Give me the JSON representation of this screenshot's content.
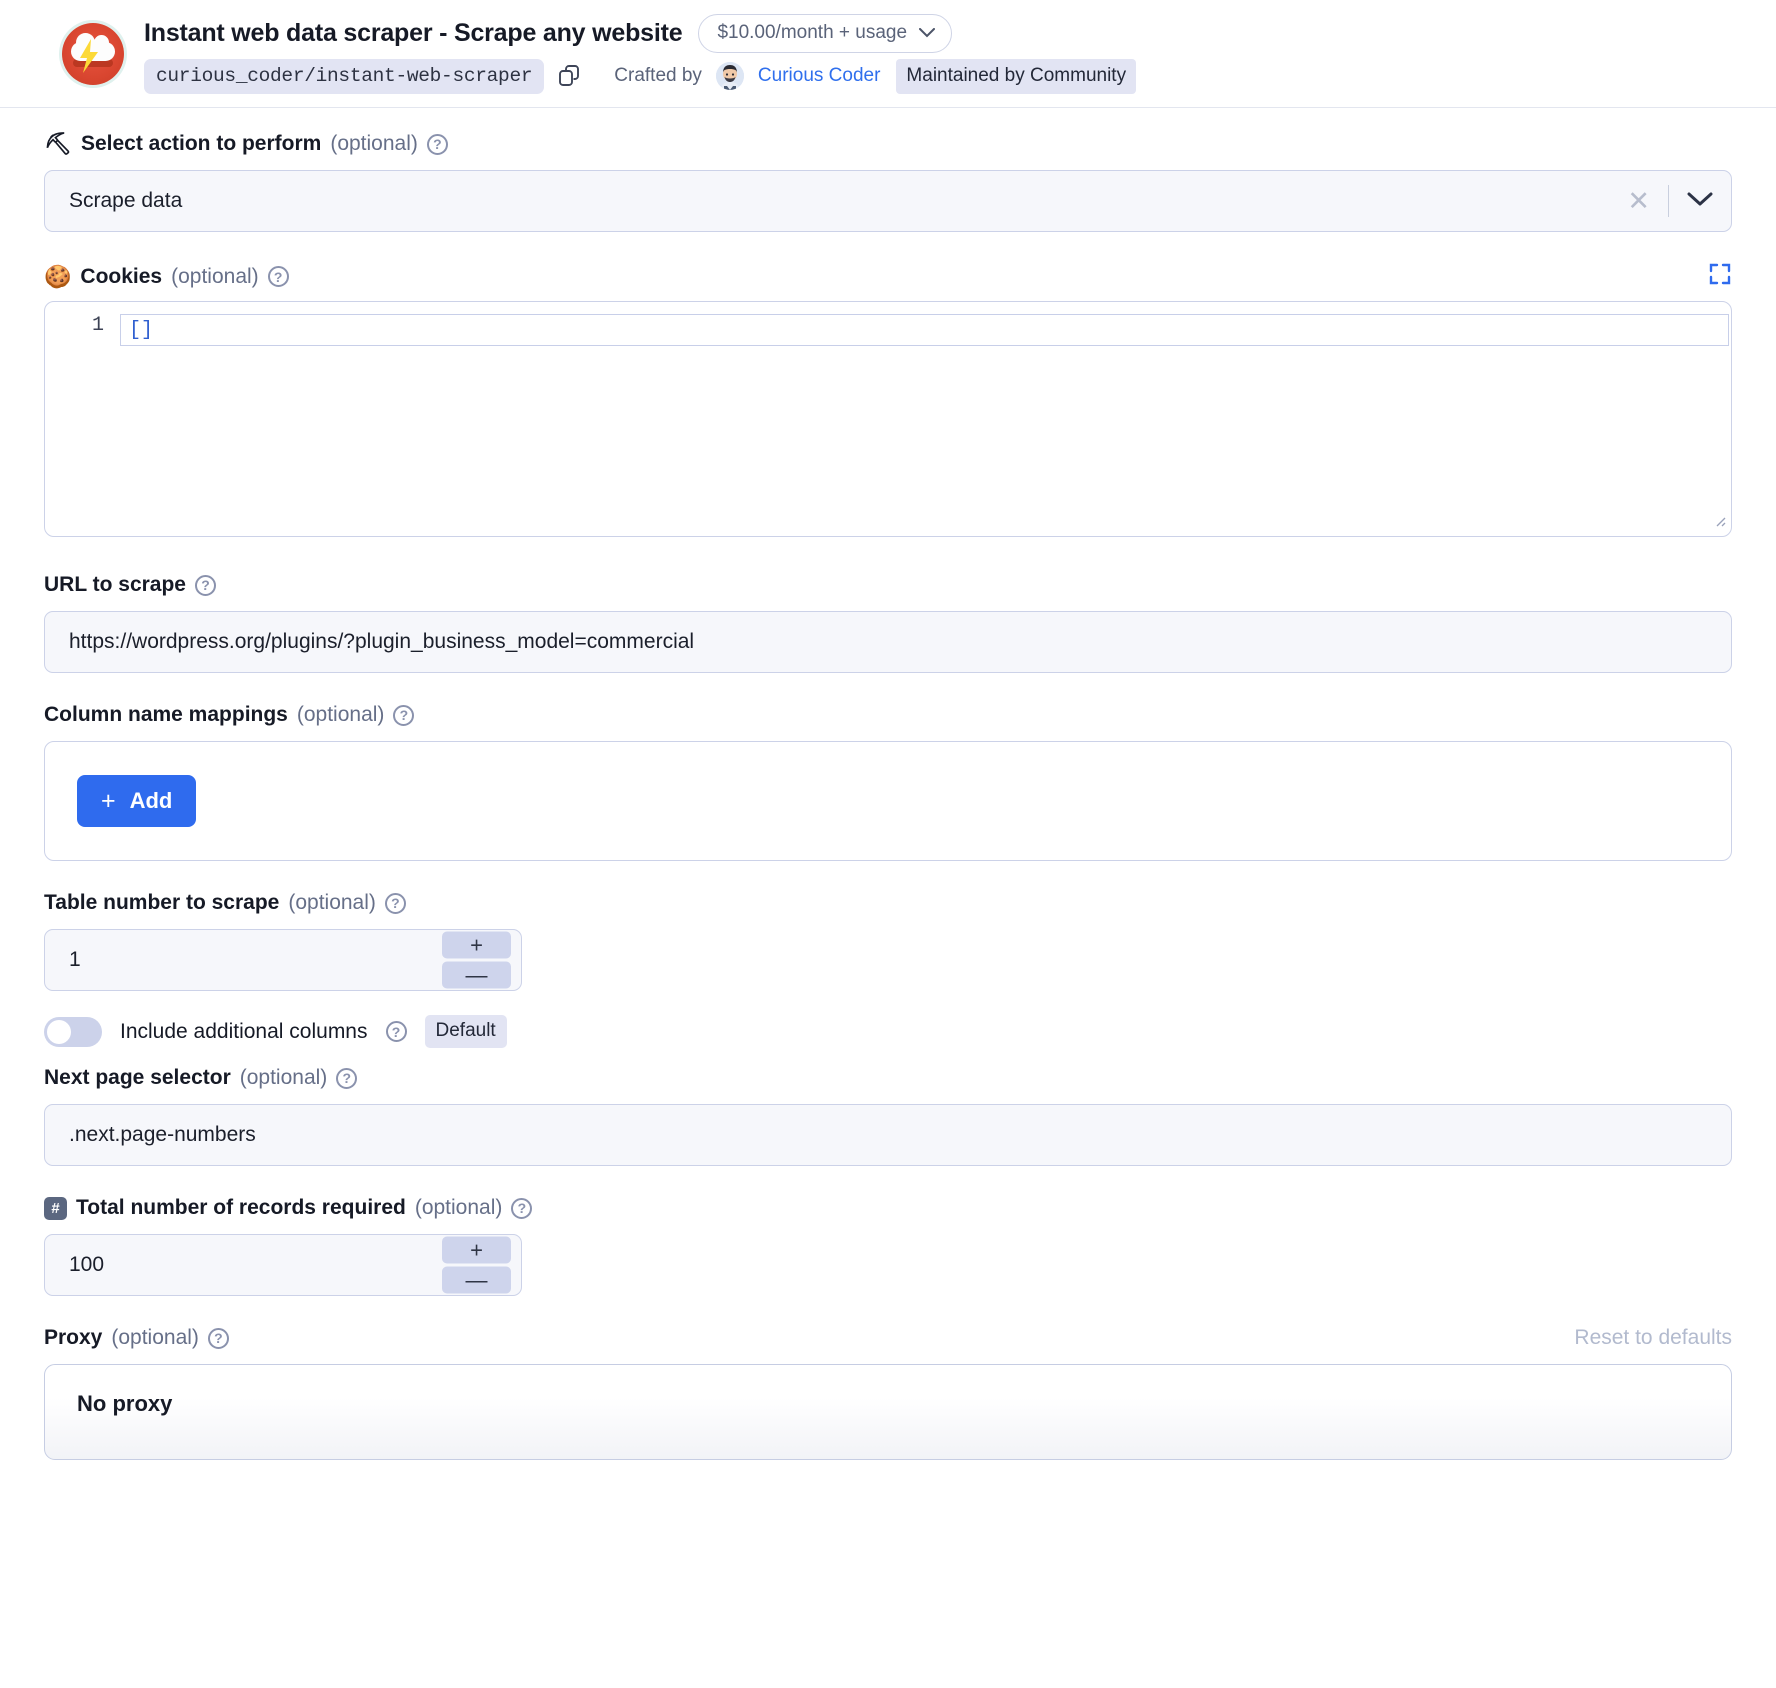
{
  "header": {
    "app_title": "Instant web data scraper - Scrape any website",
    "price_label": "$10.00/month + usage",
    "price_chevron": "chevron-down-icon",
    "slug": "curious_coder/instant-web-scraper",
    "copy_icon": "copy-icon",
    "crafted_by_label": "Crafted by",
    "author_name": "Curious Coder",
    "maintained_badge": "Maintained by Community",
    "logo_icon": "storm-cloud-logo-icon"
  },
  "fields": {
    "action": {
      "emoji": "⛏",
      "label": "Select action to perform",
      "optional": "(optional)",
      "help": "?",
      "value": "Scrape data",
      "clear_icon": "close-icon",
      "dropdown_icon": "chevron-down-icon"
    },
    "cookies": {
      "emoji": "🍪",
      "label": "Cookies",
      "optional": "(optional)",
      "help": "?",
      "expand_icon": "expand-fullscreen-icon",
      "line_number": "1",
      "code": "[]"
    },
    "url": {
      "label": "URL to scrape",
      "help": "?",
      "value": "https://wordpress.org/plugins/?plugin_business_model=commercial"
    },
    "column_mappings": {
      "label": "Column name mappings",
      "optional": "(optional)",
      "help": "?",
      "add_label": "Add",
      "add_plus": "+"
    },
    "table_number": {
      "label": "Table number to scrape",
      "optional": "(optional)",
      "help": "?",
      "value": "1",
      "increment": "+",
      "decrement": "—"
    },
    "include_additional_columns": {
      "label": "Include additional columns",
      "help": "?",
      "badge": "Default",
      "state": "off"
    },
    "next_page_selector": {
      "label": "Next page selector",
      "optional": "(optional)",
      "help": "?",
      "value": ".next.page-numbers"
    },
    "total_records": {
      "emoji": "#",
      "label": "Total number of records required",
      "optional": "(optional)",
      "help": "?",
      "value": "100",
      "increment": "+",
      "decrement": "—"
    },
    "proxy": {
      "label": "Proxy",
      "optional": "(optional)",
      "help": "?",
      "reset_label": "Reset to defaults",
      "selected": "No proxy"
    }
  },
  "colors": {
    "accent_blue": "#2f6bee",
    "link_blue": "#2f6fed",
    "badge_bg": "#e2e4f3",
    "input_bg": "#f6f7fb",
    "border": "#ccd2e8",
    "muted_text": "#666f88"
  }
}
